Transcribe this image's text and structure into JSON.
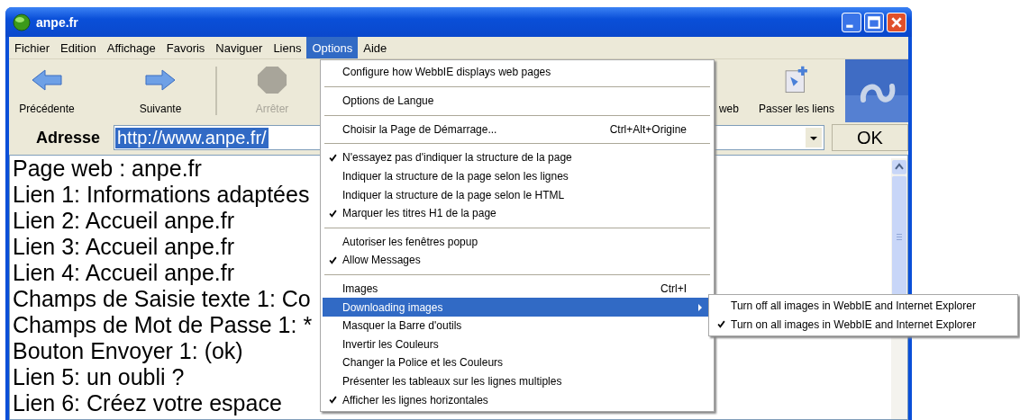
{
  "window": {
    "title": "anpe.fr"
  },
  "menu_bar": [
    {
      "label": "Fichier",
      "selected": false
    },
    {
      "label": "Edition",
      "selected": false
    },
    {
      "label": "Affichage",
      "selected": false
    },
    {
      "label": "Favoris",
      "selected": false
    },
    {
      "label": "Naviguer",
      "selected": false
    },
    {
      "label": "Liens",
      "selected": false
    },
    {
      "label": "Options",
      "selected": true
    },
    {
      "label": "Aide",
      "selected": false
    }
  ],
  "toolbar": {
    "left": [
      {
        "kind": "back",
        "label": "Précédente",
        "disabled": false
      },
      {
        "kind": "forward",
        "label": "Suivante",
        "disabled": false
      },
      {
        "kind": "stop",
        "label": "Arrêter",
        "disabled": true
      }
    ],
    "right": [
      {
        "kind": "text",
        "label": "web",
        "disabled": false
      },
      {
        "kind": "skip",
        "label": "Passer les liens",
        "disabled": false
      }
    ]
  },
  "address": {
    "label": "Adresse",
    "value": "http://www.anpe.fr/",
    "selected": true
  },
  "ok_button": "OK",
  "content": {
    "lines": [
      "Page web : anpe.fr",
      "Lien 1: Informations adaptées",
      "Lien 2: Accueil anpe.fr",
      "Lien 3: Accueil anpe.fr",
      "Lien 4: Accueil anpe.fr",
      "Champs de Saisie texte 1: Co",
      "Champs de Mot de Passe 1: *",
      "Bouton Envoyer 1: (ok)",
      "Lien 5: un oubli ?",
      "Lien 6: Créez votre espace"
    ]
  },
  "options_menu": [
    {
      "kind": "item",
      "label": "Configure how WebbIE displays web pages",
      "checked": false,
      "selected": false
    },
    {
      "kind": "separator"
    },
    {
      "kind": "item",
      "label": "Options de Langue",
      "checked": false,
      "selected": false
    },
    {
      "kind": "separator"
    },
    {
      "kind": "item",
      "label": "Choisir la Page de Démarrage...",
      "shortcut": "Ctrl+Alt+Origine",
      "checked": false,
      "selected": false
    },
    {
      "kind": "separator"
    },
    {
      "kind": "item",
      "label": "N'essayez pas d'indiquer la structure de la page",
      "checked": true,
      "selected": false
    },
    {
      "kind": "item",
      "label": "Indiquer la structure de la page selon les lignes",
      "checked": false,
      "selected": false
    },
    {
      "kind": "item",
      "label": "Indiquer la structure de la page selon le HTML",
      "checked": false,
      "selected": false
    },
    {
      "kind": "item",
      "label": "Marquer les titres H1 de la page",
      "checked": true,
      "selected": false
    },
    {
      "kind": "separator"
    },
    {
      "kind": "item",
      "label": "Autoriser les fenêtres popup",
      "checked": false,
      "selected": false
    },
    {
      "kind": "item",
      "label": "Allow Messages",
      "checked": true,
      "selected": false
    },
    {
      "kind": "separator"
    },
    {
      "kind": "item",
      "label": "Images",
      "shortcut": "Ctrl+I",
      "checked": false,
      "selected": false
    },
    {
      "kind": "submenu",
      "label": "Downloading images",
      "checked": false,
      "selected": true
    },
    {
      "kind": "item",
      "label": "Masquer la Barre d'outils",
      "checked": false,
      "selected": false
    },
    {
      "kind": "item",
      "label": "Invertir les Couleurs",
      "checked": false,
      "selected": false
    },
    {
      "kind": "item",
      "label": "Changer la Police et les Couleurs",
      "checked": false,
      "selected": false
    },
    {
      "kind": "item",
      "label": "Présenter les tableaux sur les lignes multiples",
      "checked": false,
      "selected": false
    },
    {
      "kind": "item",
      "label": "Afficher les lignes horizontales",
      "checked": true,
      "selected": false
    }
  ],
  "submenu": [
    {
      "label": "Turn off all images in WebbIE and Internet Explorer",
      "checked": false
    },
    {
      "label": "Turn on all images in WebbIE and Internet Explorer",
      "checked": true
    }
  ]
}
